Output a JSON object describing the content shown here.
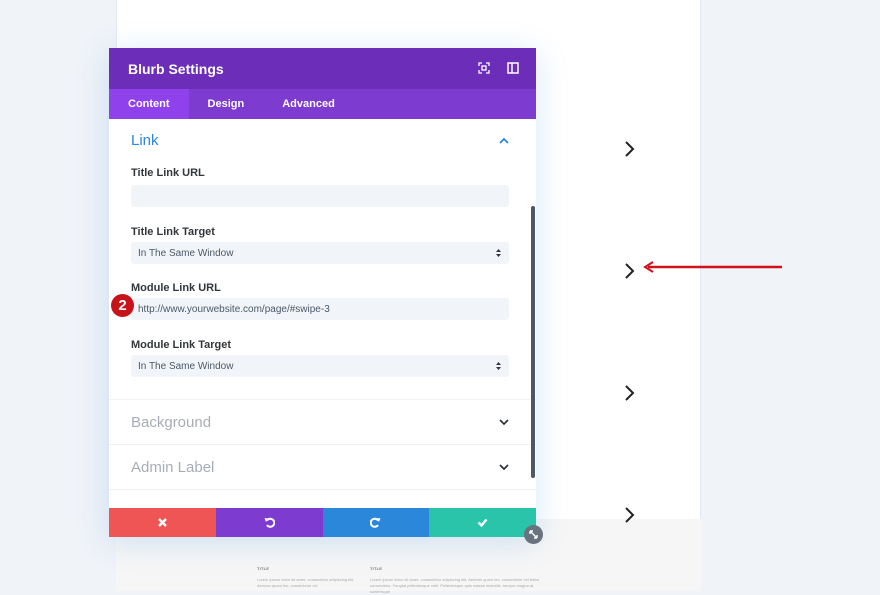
{
  "modal": {
    "title": "Blurb Settings",
    "header_icons": [
      "focus-icon",
      "sidebar-toggle-icon"
    ],
    "tabs": [
      {
        "label": "Content",
        "active": true
      },
      {
        "label": "Design",
        "active": false
      },
      {
        "label": "Advanced",
        "active": false
      }
    ],
    "sections": {
      "link": {
        "title": "Link",
        "expanded": true,
        "fields": {
          "title_link_url": {
            "label": "Title Link URL",
            "value": ""
          },
          "title_link_target": {
            "label": "Title Link Target",
            "value": "In The Same Window"
          },
          "module_link_url": {
            "label": "Module Link URL",
            "value": "http://www.yourwebsite.com/page/#swipe-3"
          },
          "module_link_target": {
            "label": "Module Link Target",
            "value": "In The Same Window"
          }
        }
      },
      "background": {
        "title": "Background",
        "expanded": false
      },
      "admin_label": {
        "title": "Admin Label",
        "expanded": false
      }
    },
    "footer": {
      "buttons": [
        "discard",
        "undo",
        "redo",
        "save"
      ],
      "colors": {
        "discard": "#ef5555",
        "undo": "#7e3bd0",
        "redo": "#2b87da",
        "save": "#29c4a9"
      }
    }
  },
  "annotation": {
    "step_number": "2",
    "color": "#c8131a"
  },
  "page_preview": {
    "chevron_count": 4,
    "footer_columns": [
      {
        "title": "TITLE",
        "text": "Lorem ipsum dolor sit amet, consectetur adipiscing elit. Aenean quam leo, consectetur vel"
      },
      {
        "title": "TITLE",
        "text": "Lorem ipsum dolor sit amet, consectetur adipiscing elit. Aenean quam leo, consectetur vel tellus consectetur. Feugiat pellentesque velit. Pellentesque quis massa molestie, tempor magna at, scelerisque"
      }
    ]
  },
  "colors": {
    "header": "#6c2eb9",
    "tabs": "#7e3bd0",
    "active_tab": "#8f42ec",
    "section_title": "#2b87da"
  }
}
